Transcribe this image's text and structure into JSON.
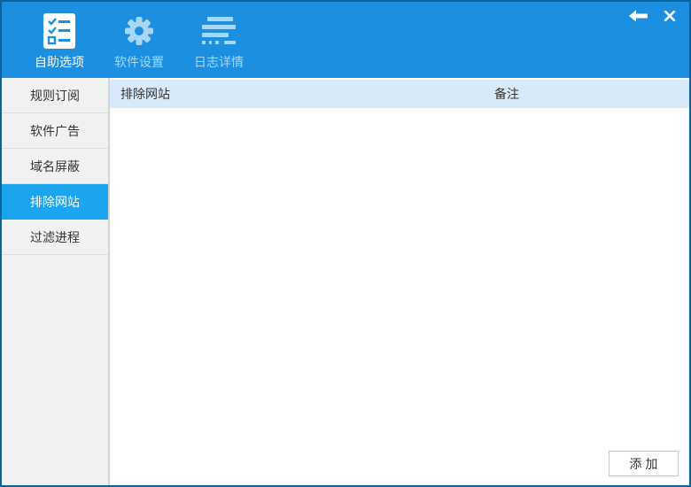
{
  "header": {
    "tabs": [
      {
        "label": "自助选项",
        "icon": "checklist-icon",
        "active": true
      },
      {
        "label": "软件设置",
        "icon": "gear-icon",
        "active": false
      },
      {
        "label": "日志详情",
        "icon": "log-icon",
        "active": false
      }
    ],
    "nav": {
      "back_icon": "left-arrow-icon",
      "close_icon": "close-icon"
    }
  },
  "sidebar": {
    "items": [
      {
        "label": "规则订阅",
        "active": false
      },
      {
        "label": "软件广告",
        "active": false
      },
      {
        "label": "域名屏蔽",
        "active": false
      },
      {
        "label": "排除网站",
        "active": true
      },
      {
        "label": "过滤进程",
        "active": false
      }
    ]
  },
  "main": {
    "table": {
      "columns": [
        "排除网站",
        "备注"
      ],
      "rows": []
    },
    "add_button_label": "添 加"
  },
  "colors": {
    "header_bg": "#1d8fe1",
    "selected_sidebar_bg": "#1aa5ee",
    "table_header_bg": "#d8eafa",
    "window_border": "#0b639c",
    "inactive_tab_color": "#a6d7f5",
    "sidebar_bg": "#f0f1f1"
  }
}
